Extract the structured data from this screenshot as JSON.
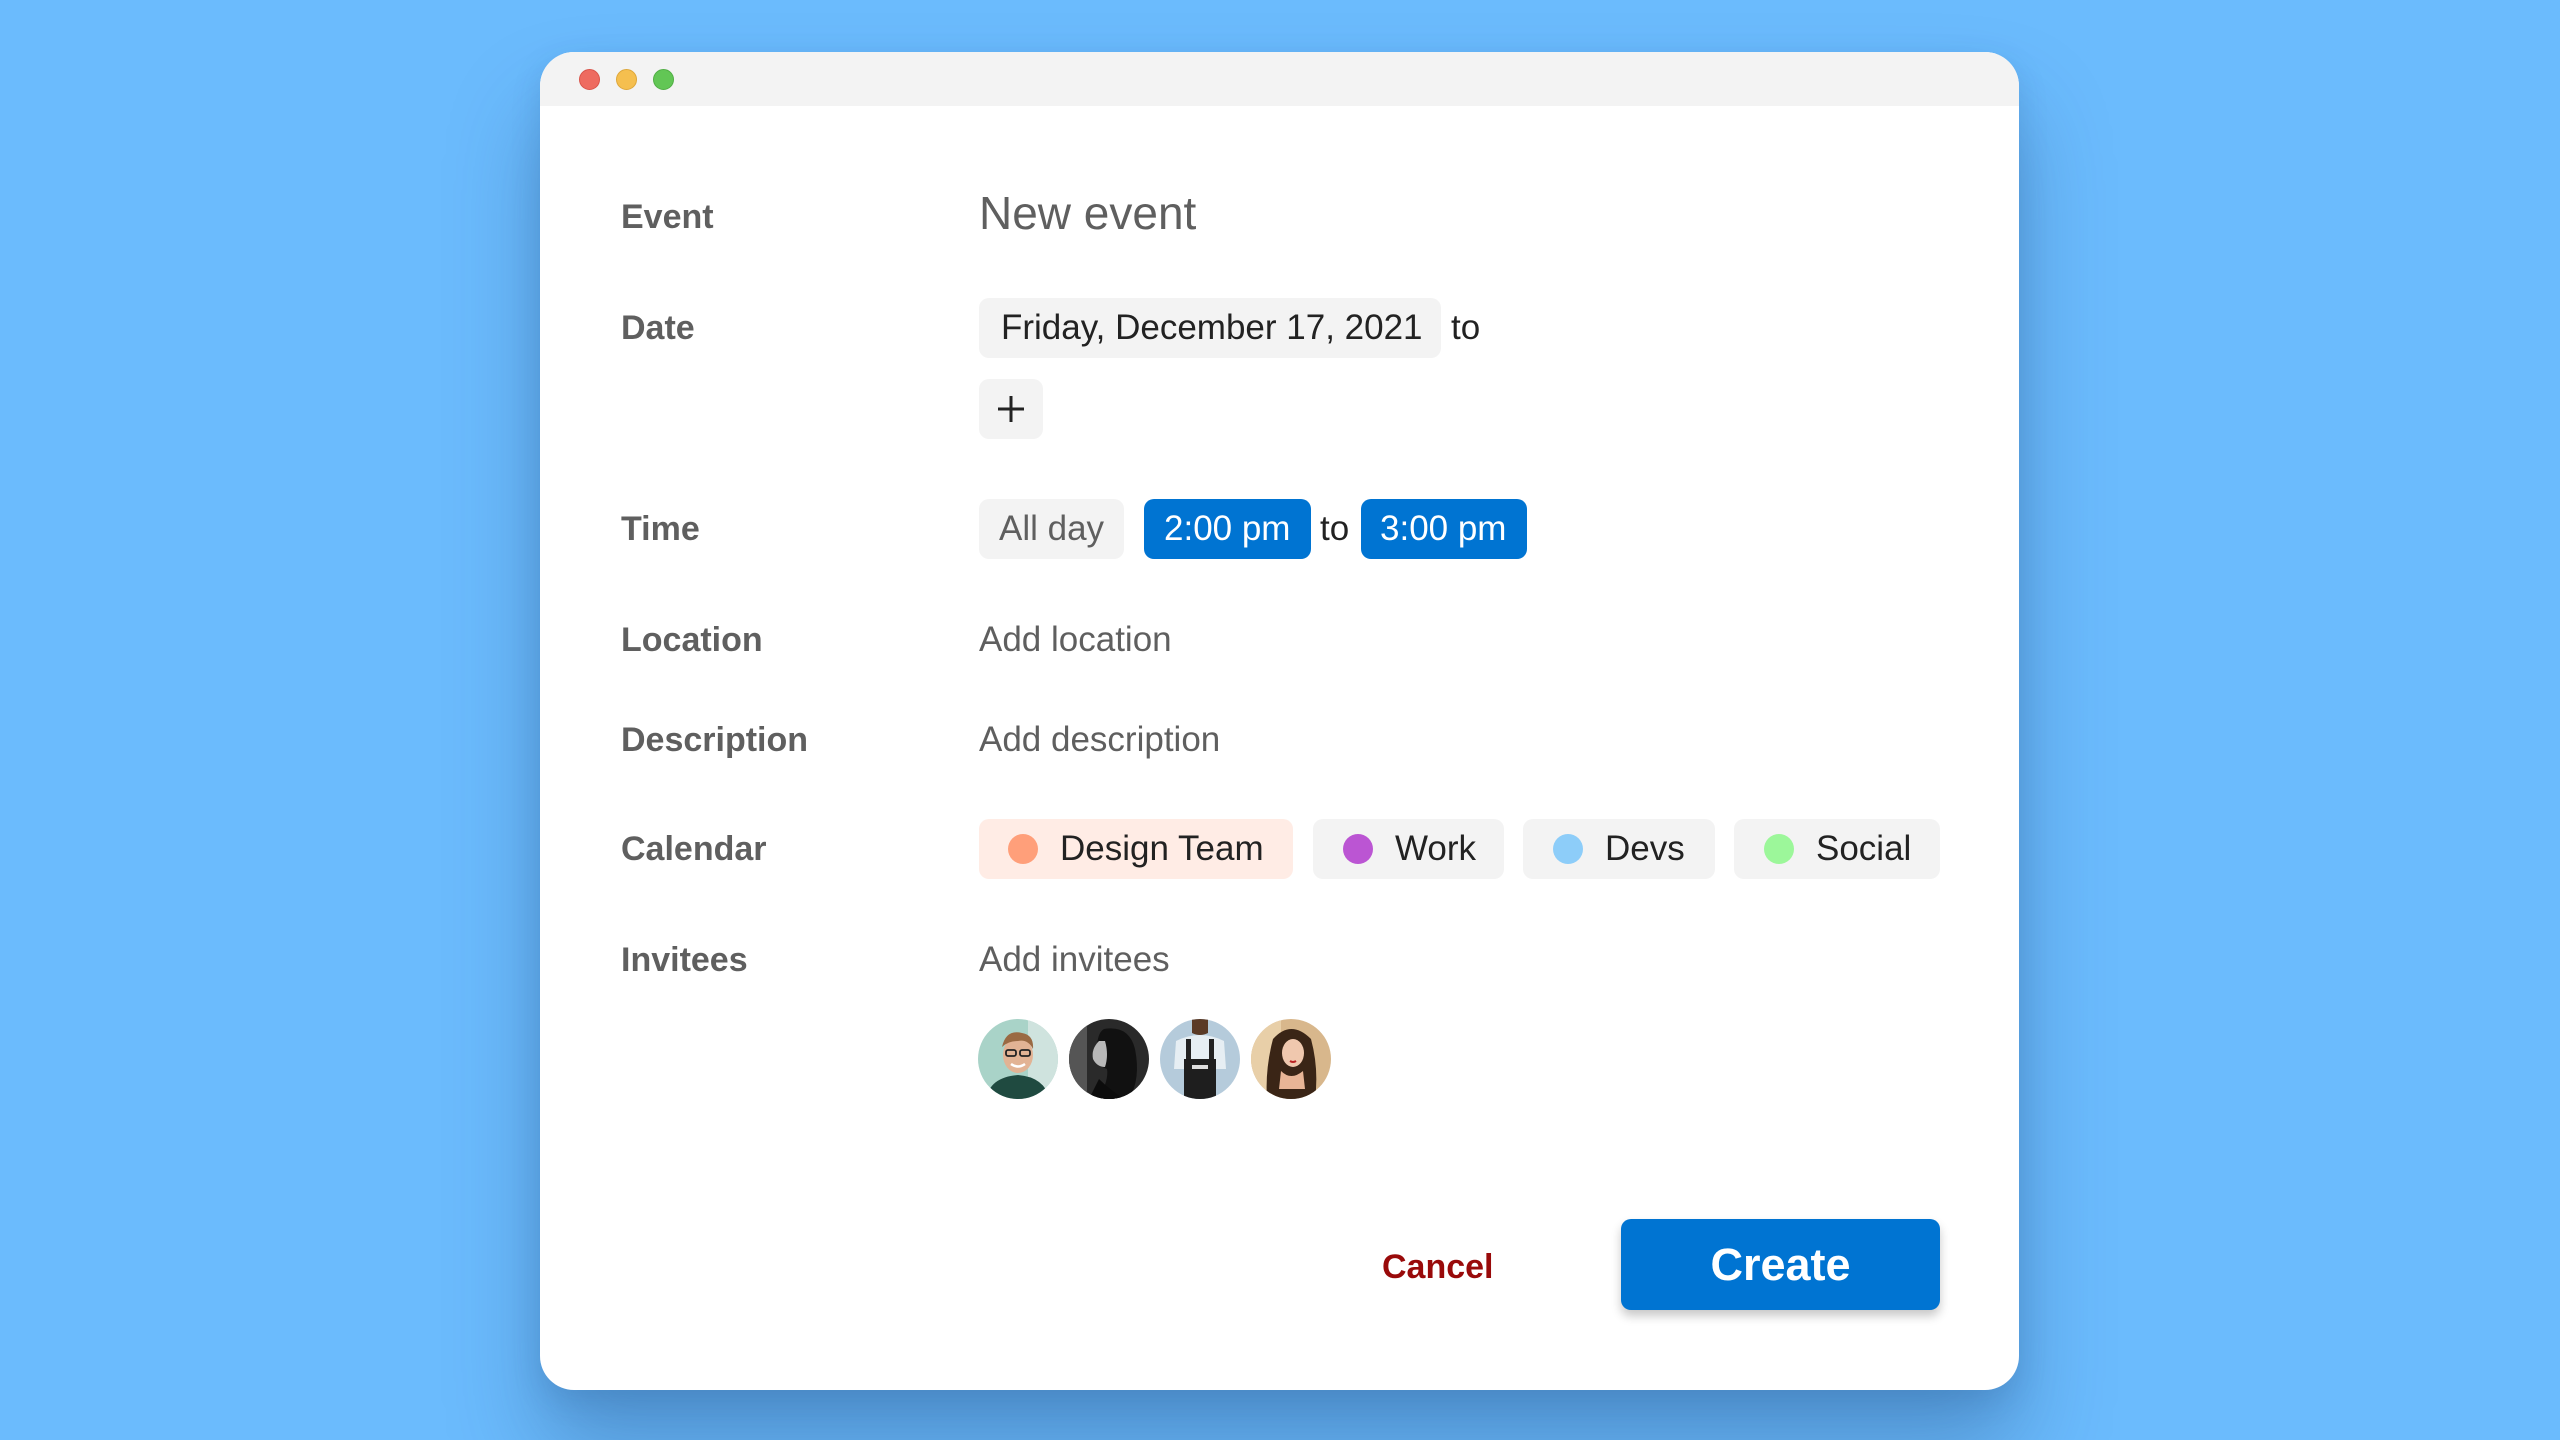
{
  "window": {
    "controls": [
      "close",
      "minimize",
      "zoom"
    ]
  },
  "form": {
    "event": {
      "label": "Event",
      "value": "New event"
    },
    "date": {
      "label": "Date",
      "start_date": "Friday, December 17, 2021",
      "separator": "to",
      "add_icon": "plus-icon"
    },
    "time": {
      "label": "Time",
      "all_day": "All day",
      "start": "2:00 pm",
      "separator": "to",
      "end": "3:00 pm"
    },
    "location": {
      "label": "Location",
      "placeholder": "Add location"
    },
    "description": {
      "label": "Description",
      "placeholder": "Add description"
    },
    "calendar": {
      "label": "Calendar",
      "options": [
        {
          "name": "Design Team",
          "color": "#ff9f7a",
          "selected": true,
          "selected_bg": "#ffece5"
        },
        {
          "name": "Work",
          "color": "#bb55d3",
          "selected": false
        },
        {
          "name": "Devs",
          "color": "#8dcdf9",
          "selected": false
        },
        {
          "name": "Social",
          "color": "#9cf79a",
          "selected": false
        }
      ]
    },
    "invitees": {
      "label": "Invitees",
      "placeholder": "Add invitees",
      "avatars": [
        "invitee-1",
        "invitee-2",
        "invitee-3",
        "invitee-4"
      ]
    }
  },
  "actions": {
    "cancel": "Cancel",
    "create": "Create"
  },
  "colors": {
    "accent": "#0074d2",
    "cancel": "#990a0a",
    "background": "#6bbbfd"
  }
}
